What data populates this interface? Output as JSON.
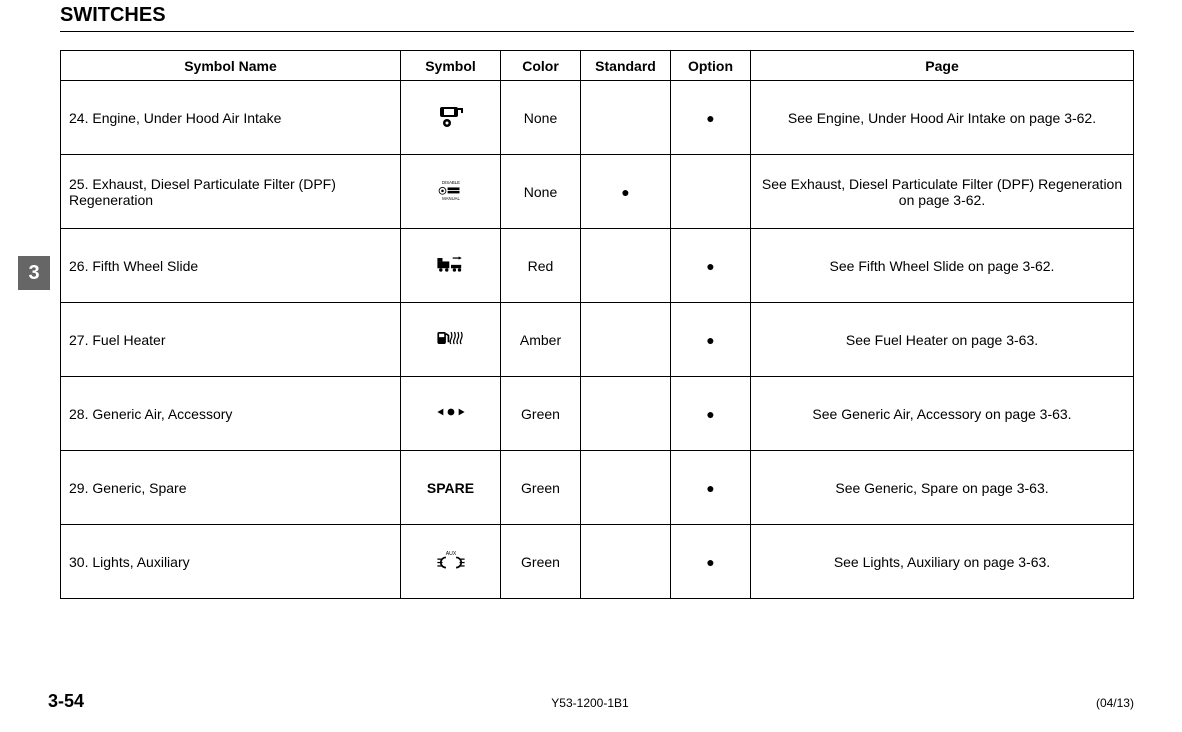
{
  "section_title": "SWITCHES",
  "side_tab": "3",
  "headers": {
    "name": "Symbol Name",
    "symbol": "Symbol",
    "color": "Color",
    "standard": "Standard",
    "option": "Option",
    "page": "Page"
  },
  "rows": [
    {
      "name": "24. Engine, Under Hood Air Intake",
      "symbol_icon": "air-intake-icon",
      "symbol_text": "",
      "color": "None",
      "standard": "",
      "option": "●",
      "page": "See Engine, Under Hood Air Intake on page 3-62."
    },
    {
      "name": "25. Exhaust, Diesel Particulate Filter (DPF) Regeneration",
      "symbol_icon": "dpf-regen-icon",
      "symbol_text": "",
      "color": "None",
      "standard": "●",
      "option": "",
      "page": "See Exhaust, Diesel Particulate Filter (DPF) Regeneration on page 3-62."
    },
    {
      "name": "26. Fifth Wheel Slide",
      "symbol_icon": "fifth-wheel-icon",
      "symbol_text": "",
      "color": "Red",
      "standard": "",
      "option": "●",
      "page": "See Fifth Wheel Slide on page 3-62."
    },
    {
      "name": "27. Fuel Heater",
      "symbol_icon": "fuel-heater-icon",
      "symbol_text": "",
      "color": "Amber",
      "standard": "",
      "option": "●",
      "page": "See Fuel Heater on page 3-63."
    },
    {
      "name": "28. Generic Air, Accessory",
      "symbol_icon": "generic-air-icon",
      "symbol_text": "",
      "color": "Green",
      "standard": "",
      "option": "●",
      "page": "See Generic Air, Accessory on page 3-63."
    },
    {
      "name": "29. Generic, Spare",
      "symbol_icon": "",
      "symbol_text": "SPARE",
      "color": "Green",
      "standard": "",
      "option": "●",
      "page": "See Generic, Spare on page 3-63."
    },
    {
      "name": "30. Lights, Auxiliary",
      "symbol_icon": "aux-lights-icon",
      "symbol_text": "",
      "color": "Green",
      "standard": "",
      "option": "●",
      "page": "See Lights, Auxiliary on page 3-63."
    }
  ],
  "footer": {
    "page_num": "3-54",
    "doc_id": "Y53-1200-1B1",
    "date": "(04/13)"
  }
}
